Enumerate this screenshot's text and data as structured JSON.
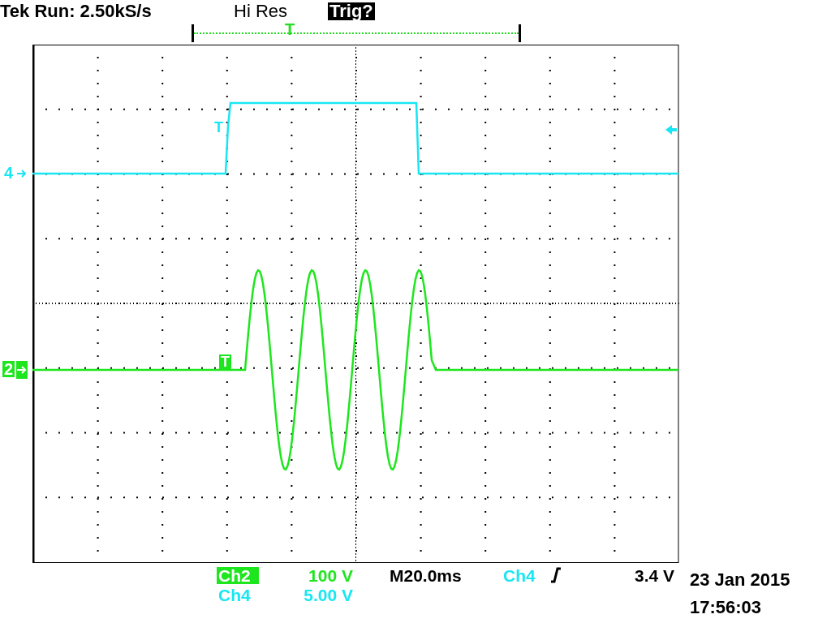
{
  "header": {
    "status": "Tek Run: 2.50kS/s",
    "acquisition_mode": "Hi Res",
    "trigger_status": "Trig?"
  },
  "record_bar": {
    "trigger_marker": "T"
  },
  "channels": [
    {
      "marker": "4",
      "trigger_marker": "T",
      "color": "#18e6f2",
      "selected": false
    },
    {
      "marker": "2",
      "trigger_marker": "T",
      "color": "#1ee61e",
      "selected": true
    }
  ],
  "readouts": [
    {
      "label": "Ch2",
      "scale": "100 V",
      "color": "#1ee61e",
      "selected": true
    },
    {
      "label": "Ch4",
      "scale": "5.00 V",
      "color": "#18e6f2",
      "selected": false
    }
  ],
  "timebase": "M20.0ms",
  "trigger": {
    "source": "Ch4",
    "color": "#18e6f2",
    "threshold": "3.4 V"
  },
  "date": "23 Jan 2015",
  "time": "17:56:03"
}
